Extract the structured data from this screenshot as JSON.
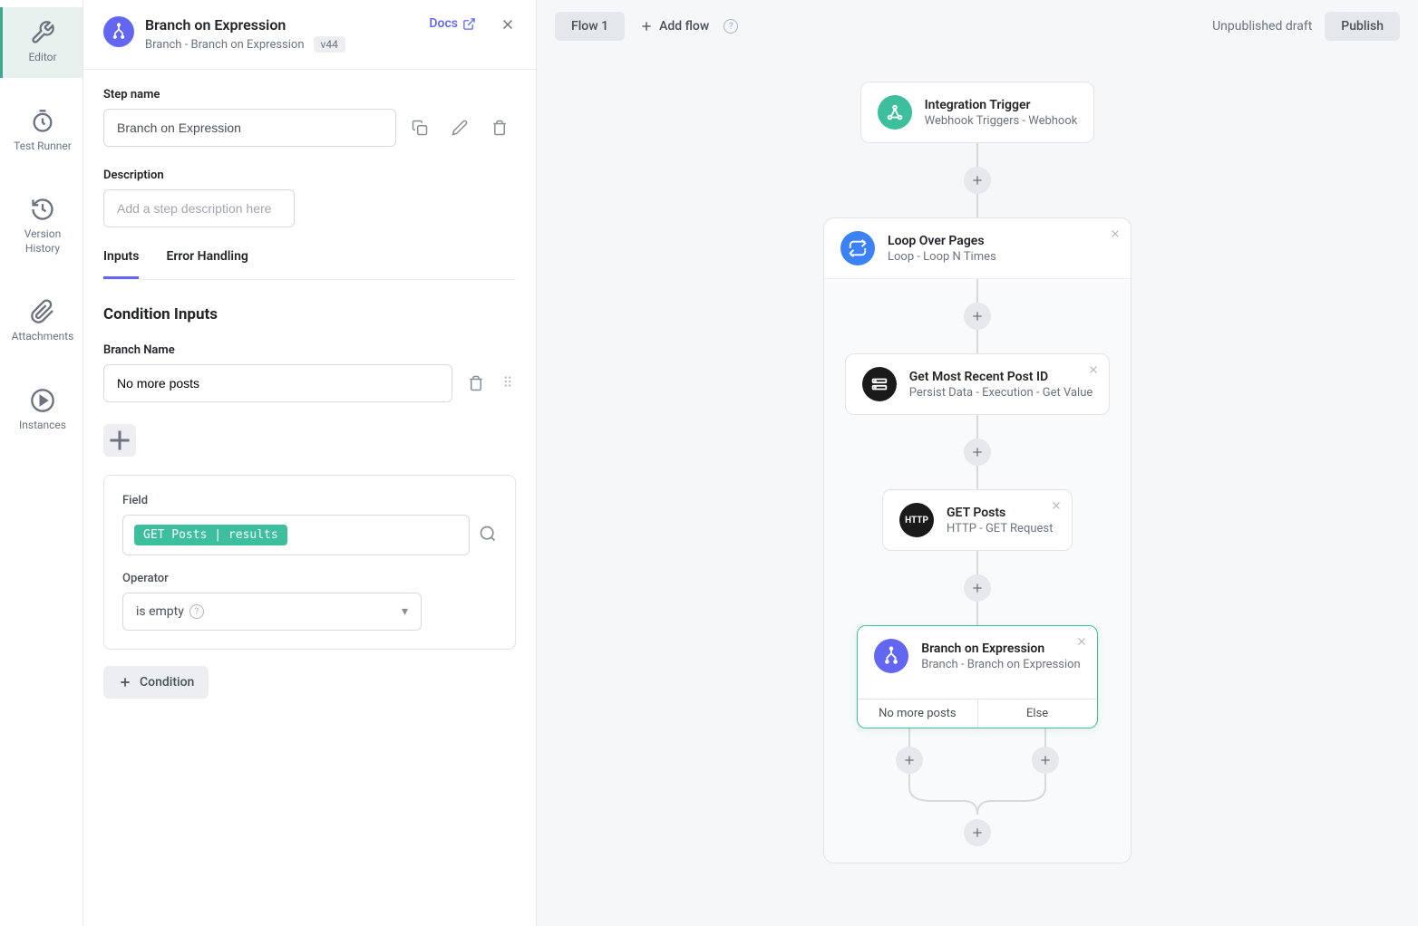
{
  "rail": {
    "items": [
      {
        "icon": "wrench",
        "label": "Editor",
        "active": true
      },
      {
        "icon": "timer",
        "label": "Test Runner"
      },
      {
        "icon": "history",
        "label": "Version History"
      },
      {
        "icon": "clip",
        "label": "Attachments"
      },
      {
        "icon": "play",
        "label": "Instances"
      }
    ]
  },
  "panel": {
    "title": "Branch on Expression",
    "subtitle": "Branch - Branch on Expression",
    "version": "v44",
    "docs": "Docs",
    "stepNameLabel": "Step name",
    "stepNameValue": "Branch on Expression",
    "descriptionLabel": "Description",
    "descriptionPlaceholder": "Add a step description here",
    "tabs": {
      "inputs": "Inputs",
      "error": "Error Handling"
    },
    "sectionHeading": "Condition Inputs",
    "branchNameLabel": "Branch Name",
    "branchNameValue": "No more posts",
    "fieldLabel": "Field",
    "fieldChip": "GET Posts | results",
    "operatorLabel": "Operator",
    "operatorValue": "is empty",
    "conditionBtn": "Condition"
  },
  "toolbar": {
    "flowTab": "Flow 1",
    "addFlow": "Add flow",
    "draft": "Unpublished draft",
    "publish": "Publish"
  },
  "flow": {
    "trigger": {
      "title": "Integration Trigger",
      "sub": "Webhook Triggers - Webhook"
    },
    "loop": {
      "title": "Loop Over Pages",
      "sub": "Loop - Loop N Times"
    },
    "persist": {
      "title": "Get Most Recent Post ID",
      "sub": "Persist Data - Execution - Get Value"
    },
    "http": {
      "title": "GET Posts",
      "sub": "HTTP - GET Request"
    },
    "branch": {
      "title": "Branch on Expression",
      "sub": "Branch - Branch on Expression",
      "left": "No more posts",
      "right": "Else"
    }
  }
}
